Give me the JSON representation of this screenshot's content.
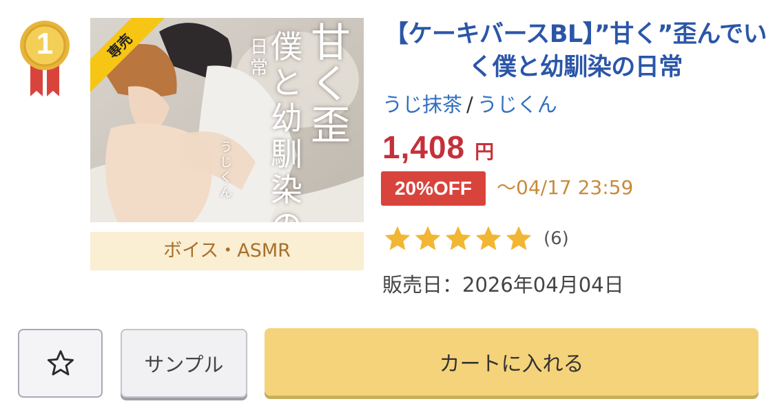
{
  "rank": {
    "number": "1",
    "icon": "gold-medal-icon",
    "colors": {
      "gold": "#e8b53c",
      "ribbon": "#d8443c"
    }
  },
  "product": {
    "cover": {
      "ribbon_label": "専売",
      "cover_title_col1": "甘く歪",
      "cover_title_col2": "僕と幼馴染の",
      "cover_title_col3": "日常",
      "cover_author": "うじくん"
    },
    "category": "ボイス・ASMR",
    "title": "【ケーキバースBL】”甘く”歪んでいく僕と幼馴染の日常",
    "circle": "うじ抹茶",
    "author_separator": "/",
    "author": "うじくん",
    "price": "1,408",
    "currency": "円",
    "discount_label": "20%OFF",
    "sale_deadline": "〜04/17 23:59",
    "rating": {
      "stars": 5,
      "max": 5,
      "count_text": "(6)"
    },
    "release": "販売日：2026年04月04日"
  },
  "actions": {
    "favorite_icon": "star-outline-icon",
    "sample_label": "サンプル",
    "cart_label": "カートに入れる"
  },
  "colors": {
    "title_blue": "#2b56a8",
    "link_blue": "#2f6fc0",
    "price_red": "#c4313b",
    "discount_red": "#d8443c",
    "deadline_orange": "#c98a3b",
    "star_gold": "#f2b632",
    "cart_yellow": "#f5d37a"
  }
}
